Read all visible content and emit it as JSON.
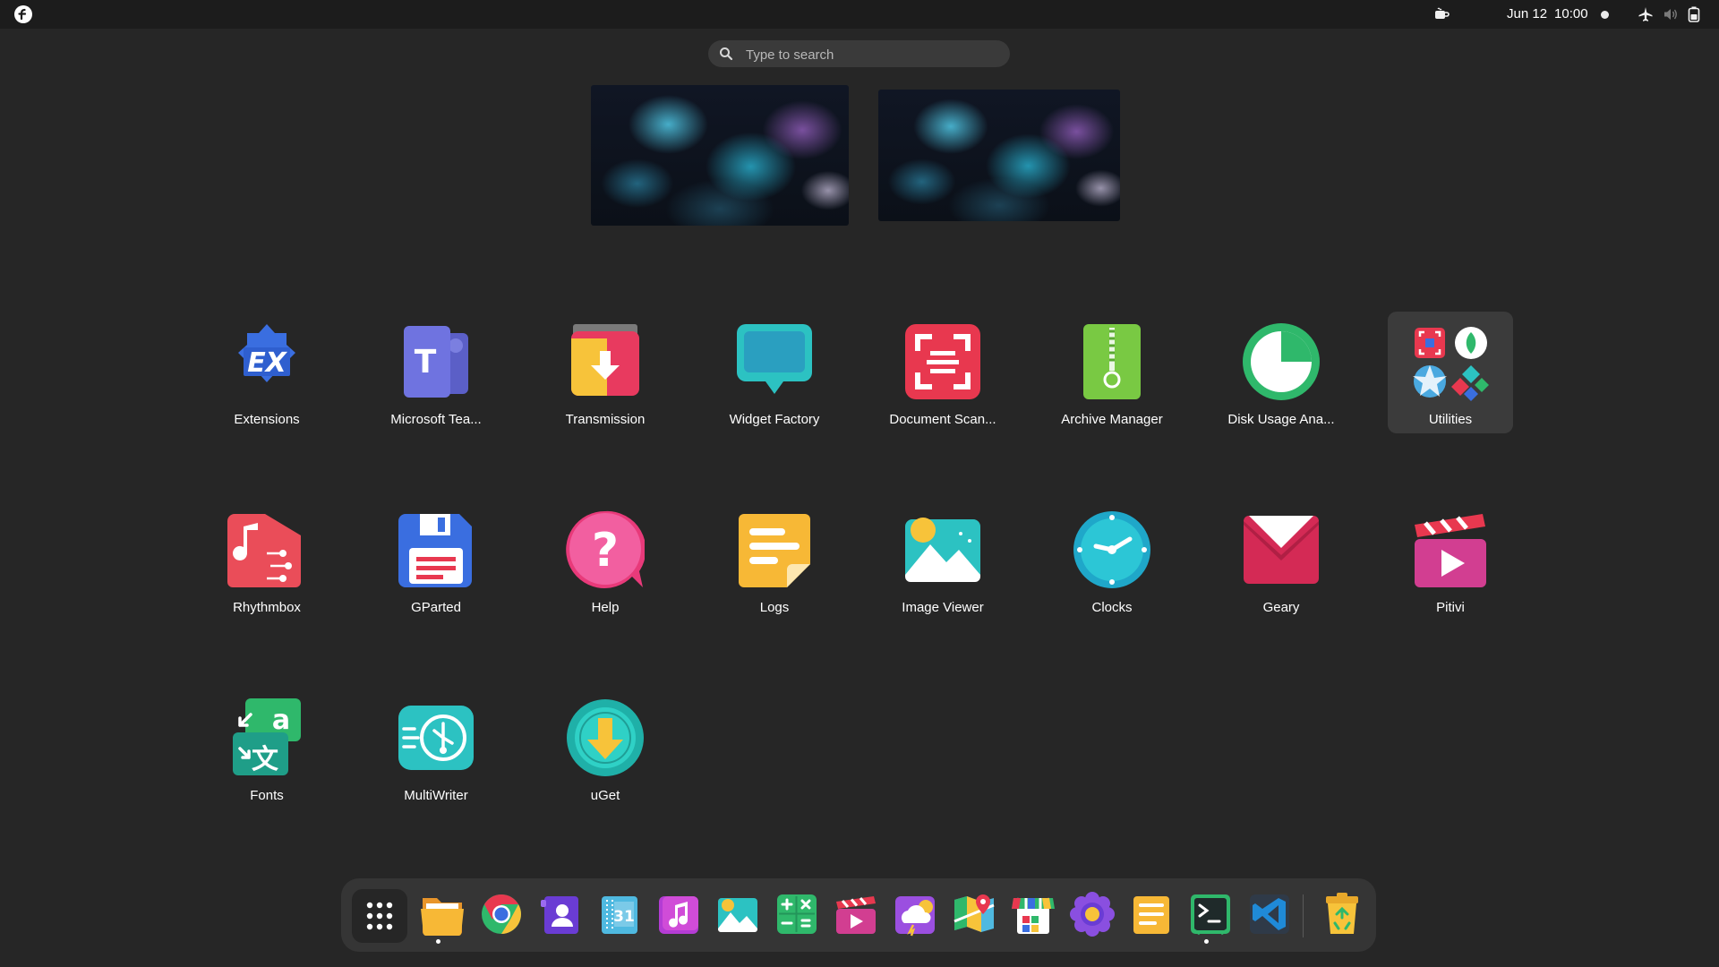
{
  "topbar": {
    "date": "Jun 12",
    "time": "10:00",
    "icons": [
      "fedora-logo-icon",
      "caffeine-cup-icon",
      "airplane-mode-icon",
      "volume-muted-icon",
      "battery-icon"
    ]
  },
  "search": {
    "placeholder": "Type to search",
    "value": ""
  },
  "apps": [
    {
      "label": "Extensions",
      "icon": "extensions-icon"
    },
    {
      "label": "Microsoft Tea...",
      "icon": "microsoft-teams-icon"
    },
    {
      "label": "Transmission",
      "icon": "transmission-icon"
    },
    {
      "label": "Widget Factory",
      "icon": "widget-factory-icon"
    },
    {
      "label": "Document Scan...",
      "icon": "document-scanner-icon"
    },
    {
      "label": "Archive Manager",
      "icon": "archive-manager-icon"
    },
    {
      "label": "Disk Usage Ana...",
      "icon": "disk-usage-analyzer-icon"
    },
    {
      "label": "Utilities",
      "icon": "utilities-folder-icon"
    },
    {
      "label": "Rhythmbox",
      "icon": "rhythmbox-icon"
    },
    {
      "label": "GParted",
      "icon": "gparted-icon"
    },
    {
      "label": "Help",
      "icon": "help-icon"
    },
    {
      "label": "Logs",
      "icon": "logs-icon"
    },
    {
      "label": "Image Viewer",
      "icon": "image-viewer-icon"
    },
    {
      "label": "Clocks",
      "icon": "clocks-icon"
    },
    {
      "label": "Geary",
      "icon": "geary-icon"
    },
    {
      "label": "Pitivi",
      "icon": "pitivi-icon"
    },
    {
      "label": "Fonts",
      "icon": "fonts-icon"
    },
    {
      "label": "MultiWriter",
      "icon": "multiwriter-icon"
    },
    {
      "label": "uGet",
      "icon": "uget-icon"
    }
  ],
  "dock": [
    "show-apps-grid-icon",
    "files-icon",
    "chrome-icon",
    "contacts-icon",
    "calendar-icon",
    "music-icon",
    "photos-icon",
    "calculator-icon",
    "videos-icon",
    "weather-icon",
    "maps-icon",
    "software-store-icon",
    "settings-flower-icon",
    "text-editor-icon",
    "terminal-icon",
    "vscode-icon",
    "trash-icon"
  ],
  "colors": {
    "background": "#262626",
    "topbar": "#1c1c1c",
    "dock": "#353535",
    "folder": "#3b3b3b"
  }
}
